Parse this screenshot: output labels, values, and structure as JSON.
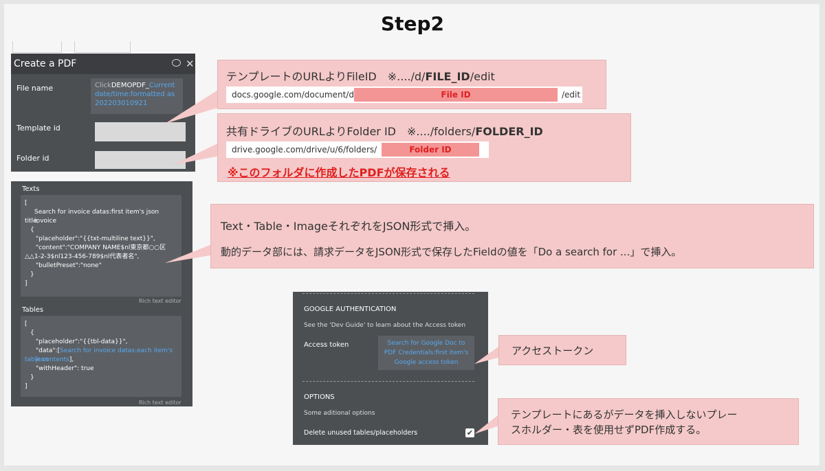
{
  "slide": {
    "title": "Step2"
  },
  "pdf_panel": {
    "header": "Create a PDF",
    "file_name_label": "File name",
    "file_name_prefix": "Click",
    "file_name_static": "DEMOPDF_",
    "file_name_dynamic": "Current date/time:formatted as 202203010921",
    "template_id_label": "Template id",
    "folder_id_label": "Folder id"
  },
  "texts_panel": {
    "label": "Texts",
    "lines": [
      "[",
      "Search for invoice datas:first item's json invoice",
      "title,",
      "{",
      "\"placeholder\":\"{{txt-multiline text}}\",",
      "\"content\":\"COMPANY NAME$nl東京都○○区",
      "△△1-2-3$nl123-456-789$nl代表者名\",",
      "\"bulletPreset\":\"none\"",
      "}",
      "]"
    ],
    "footer": "Rich text editor"
  },
  "tables_panel": {
    "label": "Tables",
    "lines": [
      "[",
      "{",
      "\"placeholder\":\"{{tbl-data}}\",",
      "\"data\":[",
      "Search for invoice datas:each item's json",
      "table contents",
      "],",
      "\"withHeader\": true",
      "}",
      "]"
    ],
    "footer": "Rich text editor"
  },
  "auth_panel": {
    "section_title": "GOOGLE AUTHENTICATION",
    "description": "See the 'Dev Guide' to learn about the Access token",
    "access_token_label": "Access token",
    "access_token_value": "Search for Google Doc to PDF Credentials:first item's Google access token",
    "options_title": "OPTIONS",
    "options_desc": "Some aditional options",
    "delete_label": "Delete unused tables/placeholders",
    "checkbox_mark": "✔"
  },
  "callouts": {
    "file_id": {
      "caption": "テンプレートのURLよりFileID　※..../d/",
      "caption_bold": "FILE_ID",
      "caption_suffix": "/edit",
      "url_prefix": "docs.google.com/document/d/",
      "url_highlight": "File ID",
      "url_suffix": "/edit"
    },
    "folder_id": {
      "caption": "共有ドライブのURLよりFolder ID　※..../folders/",
      "caption_bold": "FOLDER_ID",
      "url_prefix": "drive.google.com/drive/u/6/folders/",
      "url_highlight": "Folder ID",
      "warning": "※このフォルダに作成したPDFが保存される"
    },
    "json": {
      "line1": "Text・Table・ImageそれぞれをJSON形式で挿入。",
      "line2": "動的データ部には、請求データをJSON形式で保存したFieldの値を「Do a search for ...」で挿入。"
    },
    "access_token": {
      "text": "アクセストークン"
    },
    "unused": {
      "line1": "テンプレートにあるがデータを挿入しないプレー",
      "line2": "スホルダー・表を使用せずPDF作成する。"
    }
  },
  "colors": {
    "callout_bg": "#f5c9c9",
    "panel_bg": "#4c4f52",
    "link": "#59a8f0",
    "warning": "#e02020"
  }
}
